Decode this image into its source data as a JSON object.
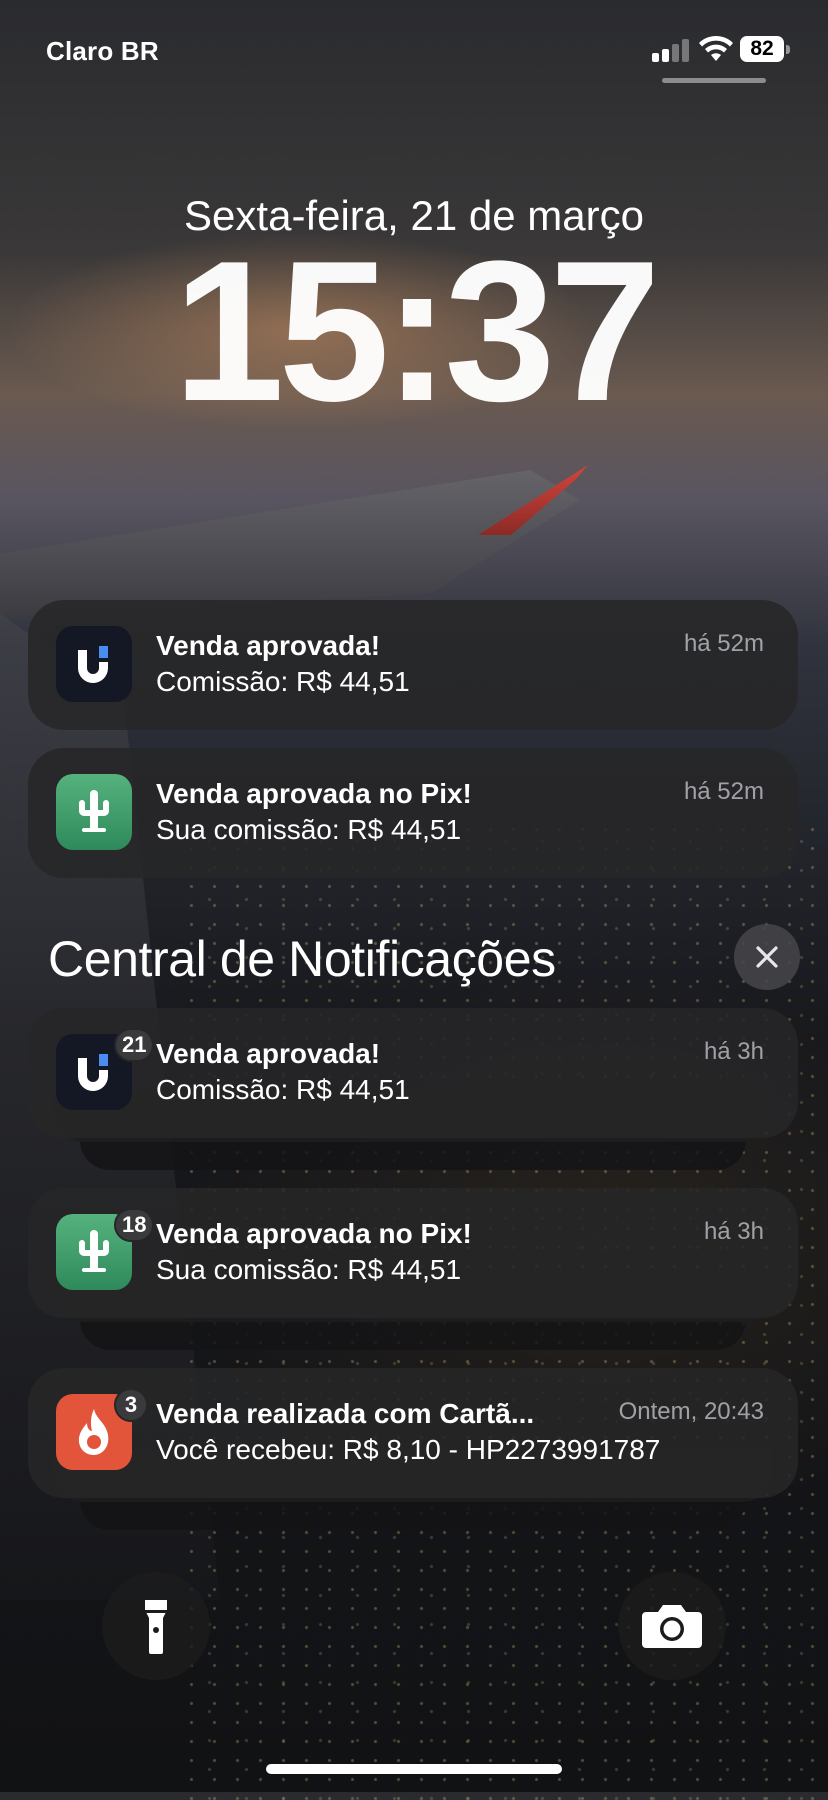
{
  "status_bar": {
    "carrier": "Claro BR",
    "battery": "82"
  },
  "lock": {
    "date": "Sexta-feira, 21 de março",
    "time": "15:37"
  },
  "recent_notifications": [
    {
      "app_icon": "u-logo-icon",
      "title": "Venda aprovada!",
      "body": "Comissão: R$ 44,51",
      "time": "há 52m"
    },
    {
      "app_icon": "cactus-icon",
      "title": "Venda aprovada no Pix!",
      "body": "Sua comissão: R$ 44,51",
      "time": "há 52m"
    }
  ],
  "notification_center": {
    "title": "Central de Notificações",
    "groups": [
      {
        "app_icon": "u-logo-icon",
        "badge": "21",
        "title": "Venda aprovada!",
        "body": "Comissão: R$ 44,51",
        "time": "há 3h"
      },
      {
        "app_icon": "cactus-icon",
        "badge": "18",
        "title": "Venda aprovada no Pix!",
        "body": "Sua comissão: R$ 44,51",
        "time": "há 3h"
      },
      {
        "app_icon": "flame-icon",
        "badge": "3",
        "title": "Venda realizada com Cartã...",
        "body": "Você recebeu: R$ 8,10 - HP2273991787",
        "time": "Ontem, 20:43"
      }
    ]
  },
  "quick_actions": {
    "left": "flashlight-icon",
    "right": "camera-icon"
  },
  "colors": {
    "u_app_bg": "#141824",
    "cactus_app_bg": "#3f9e6a",
    "flame_app_bg": "#e2553a",
    "notification_bg": "#262628"
  }
}
